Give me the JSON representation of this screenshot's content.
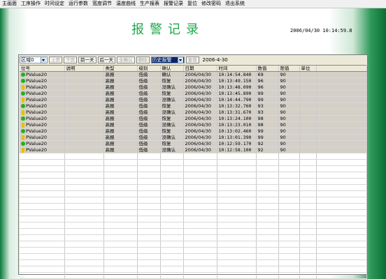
{
  "menu": [
    "主画面",
    "工序操作",
    "时间设定",
    "运行参数",
    "宽度调节",
    "温度曲线",
    "生产报表",
    "报警记录",
    "复位",
    "修改密码",
    "退出系统"
  ],
  "title": "报警记录",
  "datetime": "2006/04/30  10:14:59.8",
  "toolbar": {
    "area_select": "区域0",
    "prev_page": "上页",
    "next_page": "下页",
    "prev_day": "前一天",
    "next_day": "后一天",
    "confirm_all": "全确认",
    "delete": "删除",
    "mode_select": "历史报警",
    "query": "查询",
    "date": "2006-4-30"
  },
  "columns": [
    "位号",
    "说明",
    "类型",
    "级别",
    "确认",
    "日期",
    "时间",
    "数值",
    "限值",
    "单位"
  ],
  "rows": [
    {
      "icon": "ok",
      "tag": "PValue20",
      "desc": "",
      "type": "高报",
      "level": "低级",
      "ack": "确认",
      "date": "2006/04/30",
      "time": "10:14:54.840",
      "value": "69",
      "limit": "90",
      "unit": ""
    },
    {
      "icon": "ok",
      "tag": "PValue20",
      "desc": "",
      "type": "高报",
      "level": "低级",
      "ack": "恢复",
      "date": "2006/04/30",
      "time": "10:13:49.150",
      "value": "96",
      "limit": "90",
      "unit": ""
    },
    {
      "icon": "warn",
      "tag": "PValue20",
      "desc": "",
      "type": "高报",
      "level": "低级",
      "ack": "没确认",
      "date": "2006/04/30",
      "time": "10:13:48.090",
      "value": "96",
      "limit": "90",
      "unit": ""
    },
    {
      "icon": "ok",
      "tag": "PValue20",
      "desc": "",
      "type": "高报",
      "level": "低级",
      "ack": "恢复",
      "date": "2006/04/30",
      "time": "10:13:45.890",
      "value": "99",
      "limit": "90",
      "unit": ""
    },
    {
      "icon": "warn",
      "tag": "PValue20",
      "desc": "",
      "type": "高报",
      "level": "低级",
      "ack": "没确认",
      "date": "2006/04/30",
      "time": "10:14:44.790",
      "value": "99",
      "limit": "90",
      "unit": ""
    },
    {
      "icon": "ok",
      "tag": "PValue20",
      "desc": "",
      "type": "高报",
      "level": "低级",
      "ack": "恢复",
      "date": "2006/04/30",
      "time": "10:13:32.760",
      "value": "93",
      "limit": "90",
      "unit": ""
    },
    {
      "icon": "warn",
      "tag": "PValue20",
      "desc": "",
      "type": "高报",
      "level": "低级",
      "ack": "没确认",
      "date": "2006/04/30",
      "time": "10:13:31.670",
      "value": "93",
      "limit": "90",
      "unit": ""
    },
    {
      "icon": "ok",
      "tag": "PValue20",
      "desc": "",
      "type": "高报",
      "level": "低级",
      "ack": "恢复",
      "date": "2006/04/30",
      "time": "10:13:24.100",
      "value": "98",
      "limit": "90",
      "unit": ""
    },
    {
      "icon": "warn",
      "tag": "PValue20",
      "desc": "",
      "type": "高报",
      "level": "低级",
      "ack": "没确认",
      "date": "2006/04/30",
      "time": "10:13:23.010",
      "value": "98",
      "limit": "90",
      "unit": ""
    },
    {
      "icon": "ok",
      "tag": "PValue20",
      "desc": "",
      "type": "高报",
      "level": "低级",
      "ack": "恢复",
      "date": "2006/04/30",
      "time": "10:13:02.460",
      "value": "99",
      "limit": "90",
      "unit": ""
    },
    {
      "icon": "warn",
      "tag": "PValue20",
      "desc": "",
      "type": "高报",
      "level": "低级",
      "ack": "没确认",
      "date": "2006/04/30",
      "time": "10:13:01.390",
      "value": "99",
      "limit": "90",
      "unit": ""
    },
    {
      "icon": "ok",
      "tag": "PValue20",
      "desc": "",
      "type": "高报",
      "level": "低级",
      "ack": "恢复",
      "date": "2006/04/30",
      "time": "10:12:59.170",
      "value": "92",
      "limit": "90",
      "unit": ""
    },
    {
      "icon": "warn",
      "tag": "PValue20",
      "desc": "",
      "type": "高报",
      "level": "低级",
      "ack": "没确认",
      "date": "2006/04/30",
      "time": "10:12:58.100",
      "value": "92",
      "limit": "90",
      "unit": ""
    }
  ],
  "colors": {
    "title": "#1ea84a",
    "row_bg": "#d4d0c8",
    "ok_icon": "#22b022",
    "warn_icon": "#e8c000"
  }
}
